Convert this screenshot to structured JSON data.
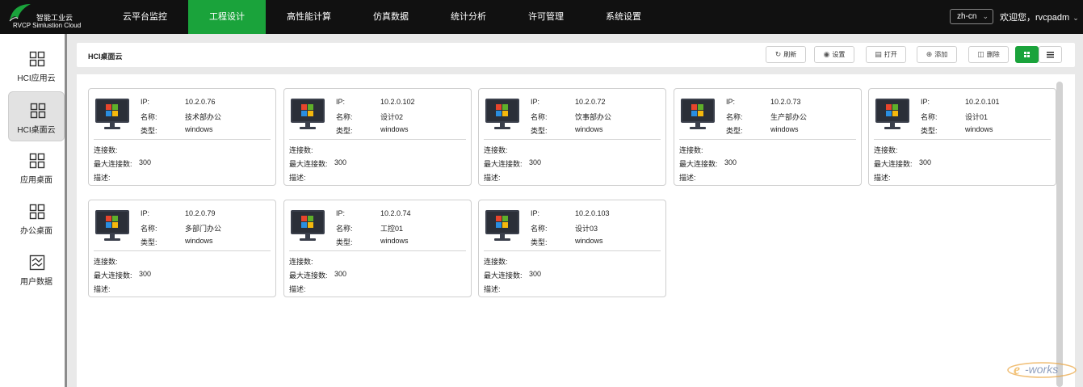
{
  "app": {
    "logo_cn": "智能工业云",
    "logo_en": "RVCP Simlustion Cloud"
  },
  "nav": [
    {
      "label": "云平台监控",
      "active": false
    },
    {
      "label": "工程设计",
      "active": true
    },
    {
      "label": "高性能计算",
      "active": false
    },
    {
      "label": "仿真数据",
      "active": false
    },
    {
      "label": "统计分析",
      "active": false
    },
    {
      "label": "许可管理",
      "active": false
    },
    {
      "label": "系统设置",
      "active": false
    }
  ],
  "header_right": {
    "lang": "zh-cn",
    "welcome": "欢迎您，rvcpadm"
  },
  "sidebar": [
    {
      "label": "HCI应用云",
      "icon": "grid-apps-icon",
      "active": false
    },
    {
      "label": "HCI桌面云",
      "icon": "grid-apps-icon",
      "active": true
    },
    {
      "label": "应用桌面",
      "icon": "grid-apps-icon",
      "active": false
    },
    {
      "label": "办公桌面",
      "icon": "grid-apps-icon",
      "active": false
    },
    {
      "label": "用户数据",
      "icon": "chart-doc-icon",
      "active": false
    }
  ],
  "page": {
    "title": "HCI桌面云"
  },
  "toolbar": {
    "refresh": "刷新",
    "settings": "设置",
    "open": "打开",
    "add": "添加",
    "delete": "删除"
  },
  "card_labels": {
    "ip": "IP:",
    "name": "名称:",
    "type": "类型:",
    "connections": "连接数:",
    "max_connections": "最大连接数:",
    "description": "描述:"
  },
  "desktops": [
    {
      "ip": "10.2.0.76",
      "name": "技术部办公",
      "type": "windows",
      "connections": "",
      "max_connections": "300",
      "description": ""
    },
    {
      "ip": "10.2.0.102",
      "name": "设计02",
      "type": "windows",
      "connections": "",
      "max_connections": "300",
      "description": ""
    },
    {
      "ip": "10.2.0.72",
      "name": "饮事部办公",
      "type": "windows",
      "connections": "",
      "max_connections": "300",
      "description": ""
    },
    {
      "ip": "10.2.0.73",
      "name": "生产部办公",
      "type": "windows",
      "connections": "",
      "max_connections": "300",
      "description": ""
    },
    {
      "ip": "10.2.0.101",
      "name": "设计01",
      "type": "windows",
      "connections": "",
      "max_connections": "300",
      "description": ""
    },
    {
      "ip": "10.2.0.79",
      "name": "多部门办公",
      "type": "windows",
      "connections": "",
      "max_connections": "300",
      "description": ""
    },
    {
      "ip": "10.2.0.74",
      "name": "工控01",
      "type": "windows",
      "connections": "",
      "max_connections": "300",
      "description": ""
    },
    {
      "ip": "10.2.0.103",
      "name": "设计03",
      "type": "windows",
      "connections": "",
      "max_connections": "300",
      "description": ""
    }
  ],
  "watermark": "e-works",
  "colors": {
    "accent": "#1aa33b",
    "topbar": "#111111"
  }
}
